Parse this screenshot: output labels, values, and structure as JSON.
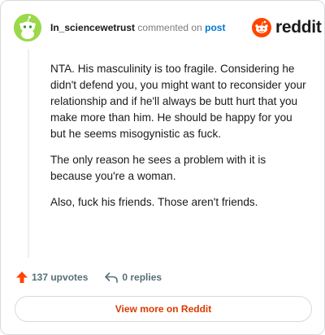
{
  "header": {
    "username": "In_sciencewetrust",
    "action_text": "commented on",
    "post_link": "post",
    "avatar_icon": "snoo-avatar-icon",
    "avatar_color": "#9bd84a"
  },
  "brand": {
    "logo_text": "reddit",
    "logo_icon": "reddit-snoo-icon",
    "accent_color": "#ff4500"
  },
  "comment": {
    "paragraphs": [
      "NTA. His masculinity is too fragile. Considering he didn't defend you, you might want to reconsider your relationship and if he'll always be butt hurt that you make more than him. He should be happy for you but he seems misogynistic as fuck.",
      "The only reason he sees a problem with it is because you're a woman.",
      "Also, fuck his friends. Those aren't friends."
    ]
  },
  "actions": {
    "upvotes_label": "137 upvotes",
    "upvote_icon": "upvote-arrow-icon",
    "replies_label": "0 replies",
    "reply_icon": "reply-arrow-icon"
  },
  "footer": {
    "view_more_label": "View more on Reddit"
  }
}
